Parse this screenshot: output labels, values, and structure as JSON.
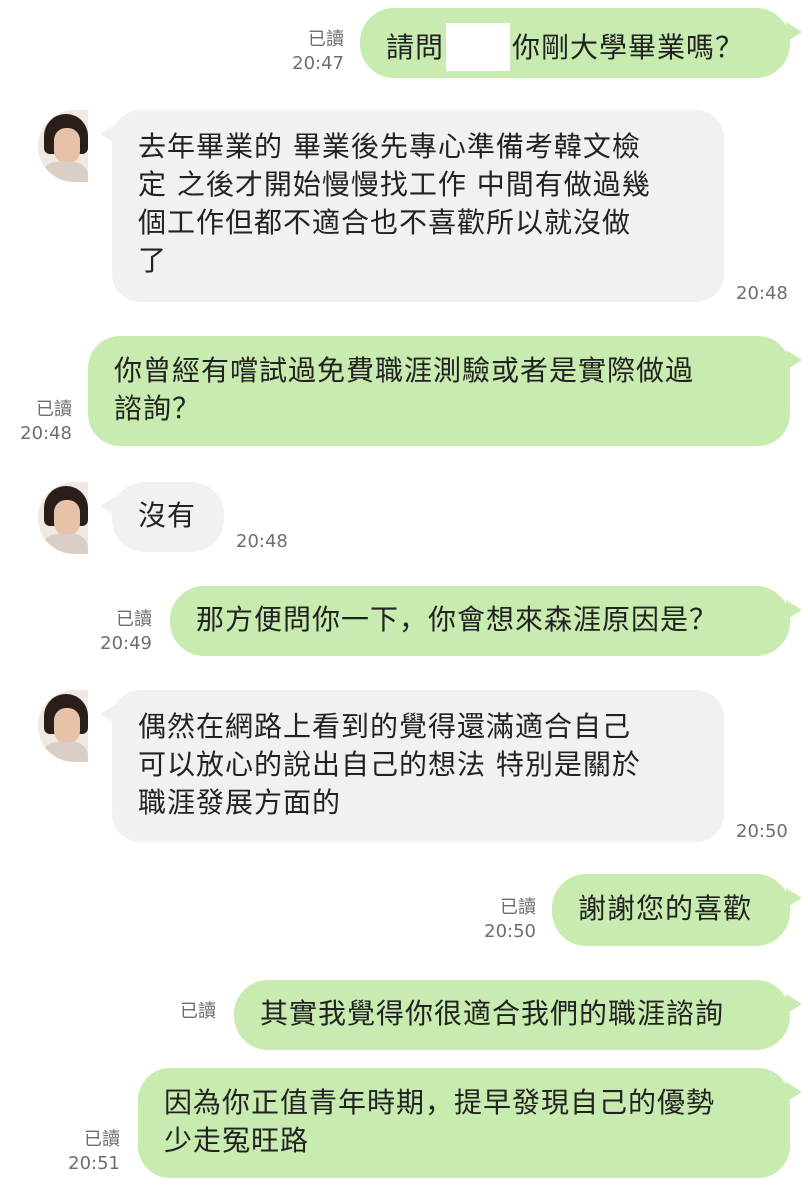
{
  "read_label": "已讀",
  "colors": {
    "outgoing_bubble": "#c8ebb0",
    "incoming_bubble": "#f1f1f3",
    "meta_text": "#6e6e6e"
  },
  "messages": [
    {
      "dir": "out",
      "text_before": "請問",
      "redacted": true,
      "text_after": "你剛大學畢業嗎？",
      "time": "20:47",
      "read": true
    },
    {
      "dir": "in",
      "lines": [
        "去年畢業的 畢業後先專心準備考韓文檢",
        "定 之後才開始慢慢找工作 中間有做過幾",
        "個工作但都不適合也不喜歡所以就沒做",
        "了"
      ],
      "time": "20:48"
    },
    {
      "dir": "out",
      "lines": [
        "你曾經有嚐試過免費職涯測驗或者是實際做過",
        "諮詢？"
      ],
      "time": "20:48",
      "read": true
    },
    {
      "dir": "in",
      "lines": [
        "沒有"
      ],
      "time": "20:48"
    },
    {
      "dir": "out",
      "lines": [
        "那方便問你一下，你會想來森涯原因是？"
      ],
      "time": "20:49",
      "read": true
    },
    {
      "dir": "in",
      "lines": [
        "偶然在網路上看到的覺得還滿適合自己",
        "可以放心的說出自己的想法 特別是關於",
        "職涯發展方面的"
      ],
      "time": "20:50"
    },
    {
      "dir": "out",
      "lines": [
        "謝謝您的喜歡"
      ],
      "time": "20:50",
      "read": true
    },
    {
      "dir": "out",
      "lines": [
        "其實我覺得你很適合我們的職涯諮詢"
      ],
      "time": "",
      "read": true
    },
    {
      "dir": "out",
      "lines": [
        "因為你正值青年時期，提早發現自己的優勢",
        "少走冤旺路"
      ],
      "time": "20:51",
      "read": true
    }
  ]
}
